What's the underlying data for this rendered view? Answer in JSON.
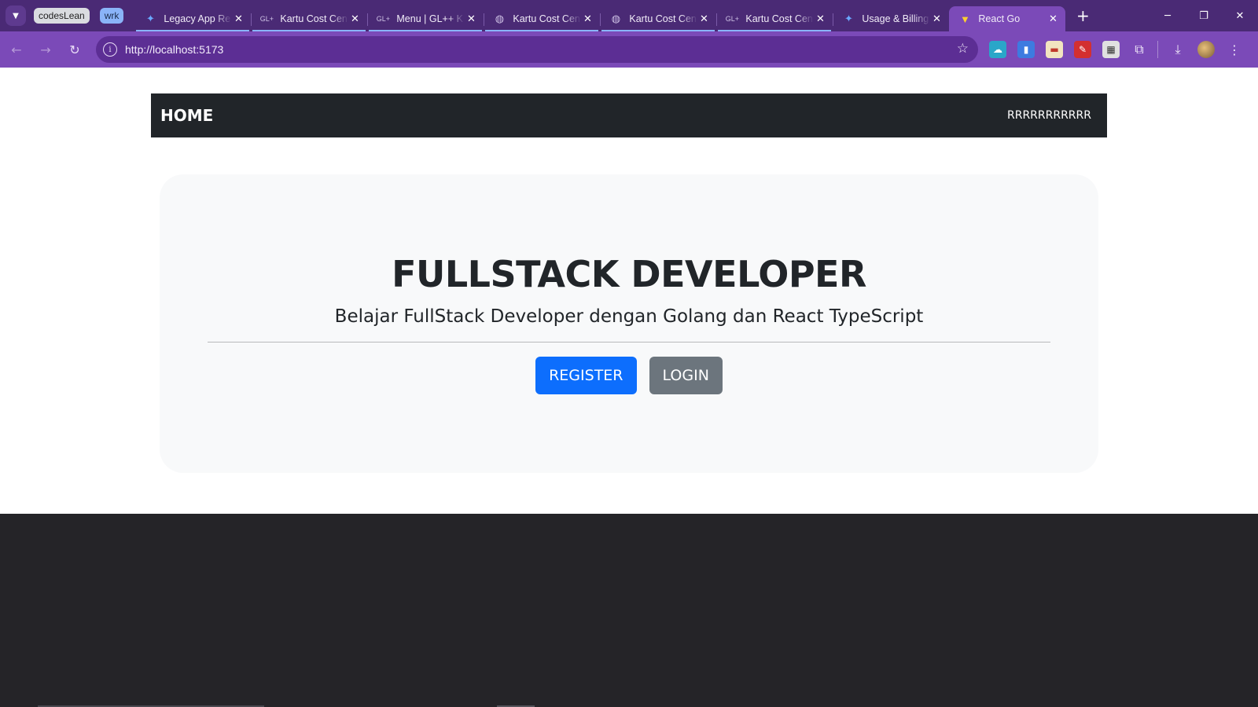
{
  "browser": {
    "tab_groups": [
      {
        "label": "codesLean"
      },
      {
        "label": "wrk"
      }
    ],
    "tabs": [
      {
        "title": "Legacy App Re",
        "icon": "butterfly-icon",
        "grouped": true
      },
      {
        "title": "Kartu Cost Cen",
        "icon": "glpp-icon",
        "grouped": true
      },
      {
        "title": "Menu | GL++ K",
        "icon": "glpp-icon",
        "grouped": true
      },
      {
        "title": "Kartu Cost Cen",
        "icon": "globe-icon",
        "grouped": true
      },
      {
        "title": "Kartu Cost Cen",
        "icon": "globe-icon",
        "grouped": true
      },
      {
        "title": "Kartu Cost Cen",
        "icon": "glpp-icon",
        "grouped": true
      },
      {
        "title": "Usage & Billing",
        "icon": "butterfly-icon",
        "grouped": false
      },
      {
        "title": "React Go",
        "icon": "vite-icon",
        "active": true
      }
    ],
    "url": "http://localhost:5173",
    "colors": {
      "frame": "#4a2a75",
      "toolbar": "#7b4ab8",
      "omnibox": "#5c2e94"
    }
  },
  "app": {
    "navbar": {
      "brand": "HOME",
      "user": "RRRRRRRRRRR"
    },
    "hero": {
      "title": "FULLSTACK DEVELOPER",
      "subtitle": "Belajar FullStack Developer dengan Golang dan React TypeScript",
      "register_label": "REGISTER",
      "login_label": "LOGIN"
    },
    "colors": {
      "navbar": "#212529",
      "primary": "#0d6efd",
      "secondary": "#6c757d",
      "hero_bg": "#f8f9fa"
    }
  }
}
